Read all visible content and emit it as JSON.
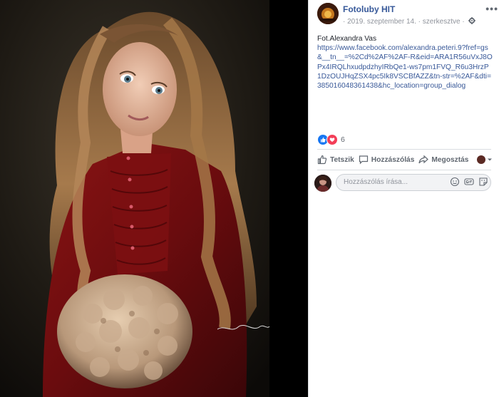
{
  "post": {
    "page_name": "Fotoluby HIT",
    "date": "2019. szeptember 14.",
    "edited": "szerkesztve",
    "separator": "·",
    "body_line": "Fot.Alexandra Vas",
    "link_text": "https://www.facebook.com/alexandra.peteri.9?fref=gs&__tn__=%2Cd%2AF%2AF-R&eid=ARA1R56uVxJ8OPx4IRQLhxudpdzhyIRbQe1-ws7pm1FVQ_R6u3HrzP1DzOUJHqZSX4pc5Ik8VSCBfAZZ&tn-str=%2AF&dti=385016048361438&hc_location=group_dialog",
    "reaction_count": "6",
    "more_menu": "•••"
  },
  "actions": {
    "like": "Tetszik",
    "comment": "Hozzászólás",
    "share": "Megosztás"
  },
  "comment_box": {
    "placeholder": "Hozzászólás írása..."
  },
  "colors": {
    "link": "#385898",
    "page_name": "#365899",
    "like_blue": "#1877f2",
    "love_red": "#f33e58"
  },
  "icons": [
    "gear-icon",
    "like-icon",
    "love-icon",
    "thumb-up-icon",
    "comment-icon",
    "share-icon",
    "emoji-icon",
    "gif-icon",
    "sticker-icon",
    "caret-down-icon",
    "more-icon"
  ]
}
